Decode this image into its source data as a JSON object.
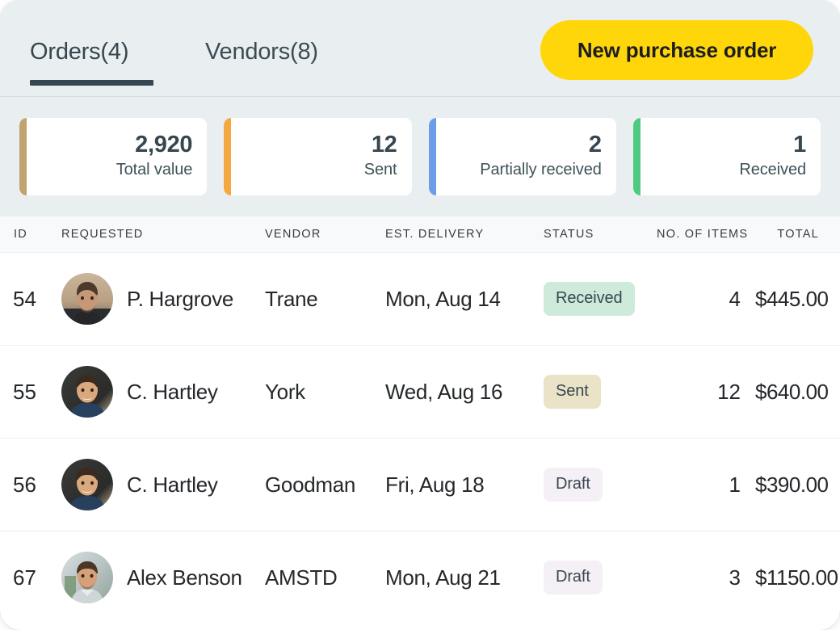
{
  "header": {
    "tabs": [
      {
        "label": "Orders(4)",
        "active": true,
        "name": "tab-orders"
      },
      {
        "label": "Vendors(8)",
        "active": false,
        "name": "tab-vendors"
      }
    ],
    "primary_button": {
      "label": "New purchase order",
      "color": "#ffd60a",
      "text_color": "#1d1d1f"
    },
    "active_tab_underline_color": "#37474f",
    "background_color": "#e9eff0"
  },
  "stats": [
    {
      "value": "2,920",
      "label": "Total value",
      "accent": "#c0a36e"
    },
    {
      "value": "12",
      "label": "Sent",
      "accent": "#f5a councils"
    },
    {
      "value": "2",
      "label": "Partially received",
      "accent": "#6d9ce8"
    },
    {
      "value": "1",
      "label": "Received",
      "accent": "#4ecb80"
    }
  ],
  "stat_accents": [
    "#c0a36e",
    "#f5a742",
    "#6d9ce8",
    "#4ecb80"
  ],
  "table": {
    "columns": [
      {
        "key": "id",
        "label": "ID"
      },
      {
        "key": "requested",
        "label": "Requested"
      },
      {
        "key": "vendor",
        "label": "Vendor"
      },
      {
        "key": "delivery",
        "label": "Est. delivery"
      },
      {
        "key": "status",
        "label": "Status"
      },
      {
        "key": "items",
        "label": "No. of items"
      },
      {
        "key": "total",
        "label": "Total"
      }
    ],
    "rows": [
      {
        "id": "54",
        "requested": "P. Hargrove",
        "vendor": "Trane",
        "delivery": "Mon, Aug 14",
        "status": "Received",
        "status_style": "received",
        "items": "4",
        "total": "$445.00",
        "avatar": "avatar-hargrove"
      },
      {
        "id": "55",
        "requested": "C. Hartley",
        "vendor": "York",
        "delivery": "Wed, Aug 16",
        "status": "Sent",
        "status_style": "sent",
        "items": "12",
        "total": "$640.00",
        "avatar": "avatar-hartley"
      },
      {
        "id": "56",
        "requested": "C. Hartley",
        "vendor": "Goodman",
        "delivery": "Fri, Aug 18",
        "status": "Draft",
        "status_style": "draft",
        "items": "1",
        "total": "$390.00",
        "avatar": "avatar-hartley"
      },
      {
        "id": "67",
        "requested": "Alex Benson",
        "vendor": "AMSTD",
        "delivery": "Mon, Aug 21",
        "status": "Draft",
        "status_style": "draft",
        "items": "3",
        "total": "$1150.00",
        "avatar": "avatar-benson"
      }
    ]
  },
  "badge_colors": {
    "received": "#cdeada",
    "sent": "#eae3c8",
    "draft": "#f5f0f6"
  }
}
